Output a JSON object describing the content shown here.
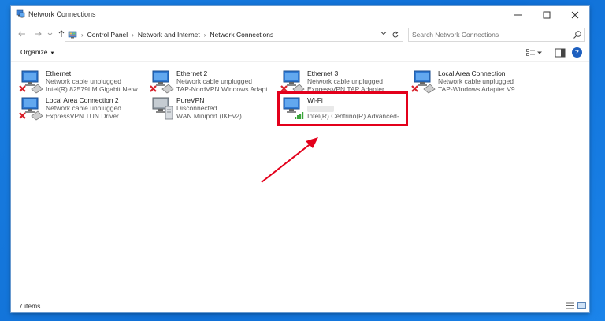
{
  "window": {
    "title": "Network Connections",
    "icon": "network-connections-icon"
  },
  "address": {
    "crumbs": [
      "Control Panel",
      "Network and Internet",
      "Network Connections"
    ],
    "search_placeholder": "Search Network Connections"
  },
  "toolbar": {
    "organize_label": "Organize",
    "help_label": "?"
  },
  "connections": [
    {
      "name": "Ethernet",
      "status": "Network cable unplugged",
      "adapter": "Intel(R) 82579LM Gigabit Network...",
      "state": "unplugged"
    },
    {
      "name": "Ethernet 2",
      "status": "Network cable unplugged",
      "adapter": "TAP-NordVPN Windows Adapter ...",
      "state": "unplugged"
    },
    {
      "name": "Ethernet 3",
      "status": "Network cable unplugged",
      "adapter": "ExpressVPN TAP Adapter",
      "state": "unplugged"
    },
    {
      "name": "Local Area Connection",
      "status": "Network cable unplugged",
      "adapter": "TAP-Windows Adapter V9",
      "state": "unplugged"
    },
    {
      "name": "Local Area Connection 2",
      "status": "Network cable unplugged",
      "adapter": "ExpressVPN TUN Driver",
      "state": "unplugged"
    },
    {
      "name": "PureVPN",
      "status": "Disconnected",
      "adapter": "WAN Miniport (IKEv2)",
      "state": "vpn-disconnected"
    },
    {
      "name": "Wi-Fi",
      "status": "",
      "adapter": "Intel(R) Centrino(R) Advanced-N ...",
      "state": "wifi-connected"
    }
  ],
  "statusbar": {
    "count": "7 items"
  },
  "colors": {
    "highlight": "#e3001b",
    "desktop": "#1a7ee0",
    "error_x": "#d8202a",
    "signal": "#3aa53a"
  }
}
